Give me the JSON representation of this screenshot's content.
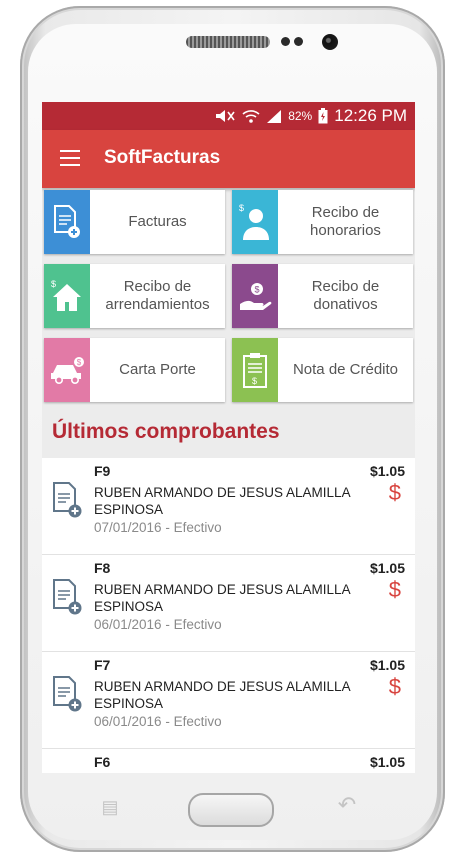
{
  "status": {
    "battery": "82%",
    "time": "12:26 PM"
  },
  "appbar": {
    "title": "SoftFacturas"
  },
  "tiles": [
    {
      "label": "Facturas",
      "color": "#3d8fd6",
      "icon": "invoice-add-icon"
    },
    {
      "label": "Recibo de honorarios",
      "color": "#3ab6d6",
      "icon": "person-icon"
    },
    {
      "label": "Recibo de arrendamientos",
      "color": "#4fc28f",
      "icon": "house-icon"
    },
    {
      "label": "Recibo de donativos",
      "color": "#8b4a8d",
      "icon": "donation-hand-icon"
    },
    {
      "label": "Carta Porte",
      "color": "#e27aa6",
      "icon": "car-icon"
    },
    {
      "label": "Nota de Crédito",
      "color": "#8cc152",
      "icon": "clipboard-icon"
    }
  ],
  "section": {
    "title": "Últimos comprobantes"
  },
  "receipts": [
    {
      "folio": "F9",
      "client": "RUBEN ARMANDO DE JESUS ALAMILLA ESPINOSA",
      "date": "07/01/2016 - Efectivo",
      "amount": "$1.05",
      "currency_symbol": "$"
    },
    {
      "folio": "F8",
      "client": "RUBEN ARMANDO DE JESUS ALAMILLA ESPINOSA",
      "date": "06/01/2016 - Efectivo",
      "amount": "$1.05",
      "currency_symbol": "$"
    },
    {
      "folio": "F7",
      "client": "RUBEN ARMANDO DE JESUS ALAMILLA ESPINOSA",
      "date": "06/01/2016 - Efectivo",
      "amount": "$1.05",
      "currency_symbol": "$"
    },
    {
      "folio": "F6",
      "client": "",
      "date": "",
      "amount": "$1.05",
      "currency_symbol": ""
    }
  ],
  "colors": {
    "status_bar": "#b52a35",
    "app_bar": "#d8443f",
    "accent": "#b52a35"
  }
}
